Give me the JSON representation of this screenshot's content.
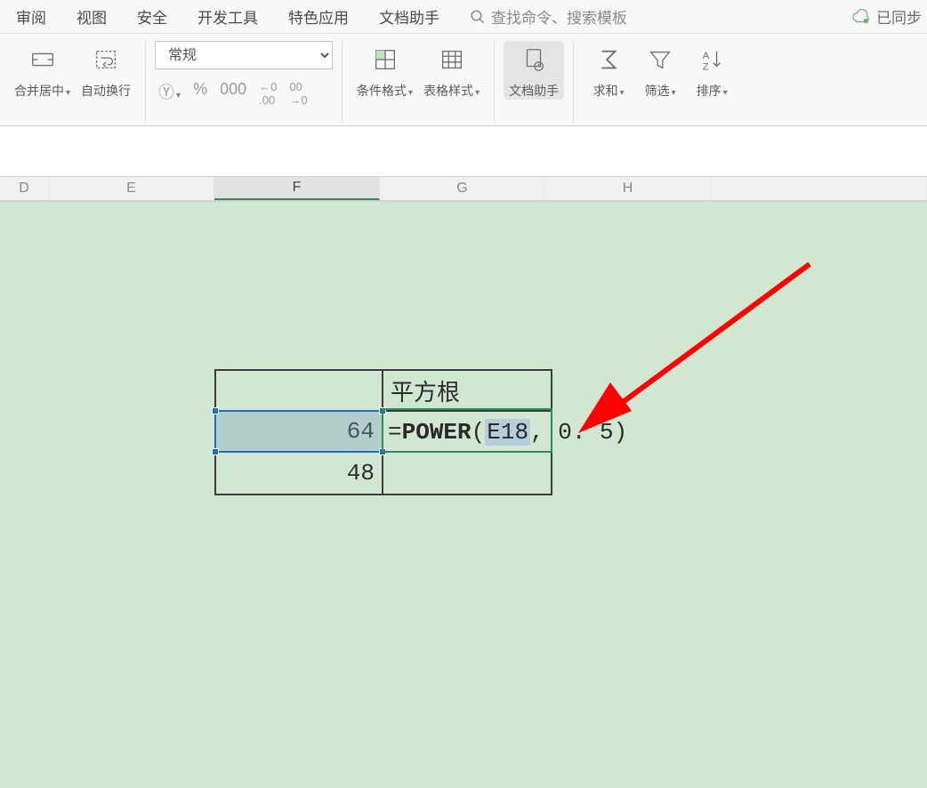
{
  "menu": {
    "items": [
      "审阅",
      "视图",
      "安全",
      "开发工具",
      "特色应用",
      "文档助手"
    ],
    "search_placeholder": "查找命令、搜索模板",
    "sync_label": "已同步"
  },
  "ribbon": {
    "merge_label": "合并居中",
    "wrap_label": "自动换行",
    "format_selected": "常规",
    "currency_icon": "¥",
    "percent_icon": "%",
    "comma_icon": "000",
    "inc_dec": "→0",
    "dec_dec": "00",
    "cond_format": "条件格式",
    "table_style": "表格样式",
    "doc_helper": "文档助手",
    "sum": "求和",
    "filter": "筛选",
    "sort": "排序"
  },
  "columns": [
    "D",
    "E",
    "F",
    "G",
    "H"
  ],
  "active_col": "F",
  "table": {
    "header": "平方根",
    "val1": "64",
    "val2": "48"
  },
  "formula": {
    "eq": "=",
    "fn": "POWER",
    "open": "(",
    "ref": "E18",
    "rest": ", 0. 5)"
  }
}
